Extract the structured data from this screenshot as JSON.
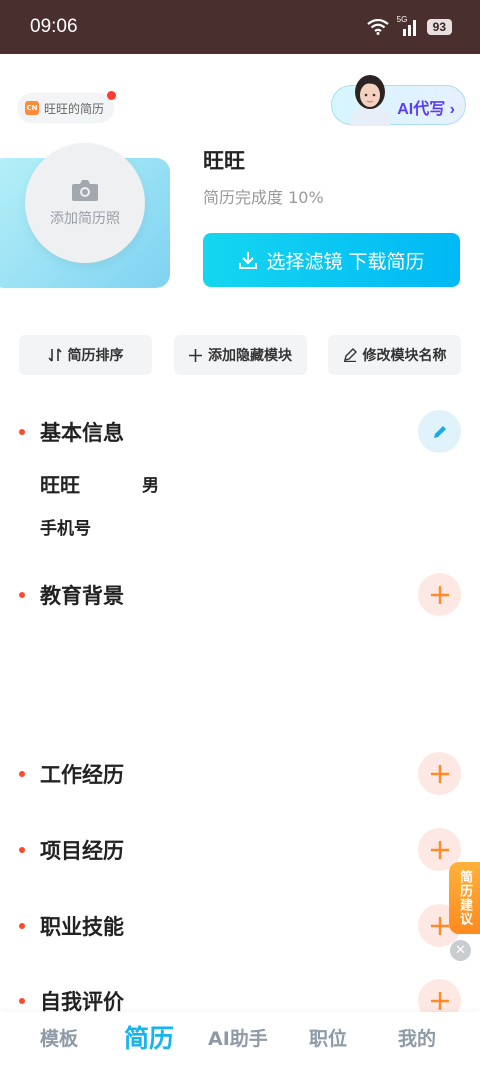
{
  "status_bar": {
    "time": "09:06",
    "network": "5G",
    "battery": "93"
  },
  "header": {
    "resume_tag": "旺旺的简历",
    "ai_write_label": "AI代写"
  },
  "profile": {
    "photo_label": "添加简历照",
    "name": "旺旺",
    "completion": "简历完成度 10%",
    "download_button": "选择滤镜 下载简历"
  },
  "toolbar": {
    "sort_label": "简历排序",
    "toggle_modules_label": "添加隐藏模块",
    "rename_modules_label": "修改模块名称"
  },
  "sections": {
    "basic_info": "基本信息",
    "education": "教育背景",
    "work": "工作经历",
    "project": "项目经历",
    "skills": "职业技能",
    "self_eval": "自我评价"
  },
  "basic_info": {
    "name": "旺旺",
    "gender": "男",
    "phone_label": "手机号"
  },
  "suggest_tab": "简历建议",
  "bottom_nav": {
    "templates": "模板",
    "resume": "简历",
    "ai_assistant": "AI助手",
    "jobs": "职位",
    "mine": "我的"
  },
  "colors": {
    "accent": "#12b5ee",
    "section_dot": "#ff4a2d",
    "add_icon": "#ff8a2a",
    "status_bar_bg": "#4a2f2f"
  }
}
